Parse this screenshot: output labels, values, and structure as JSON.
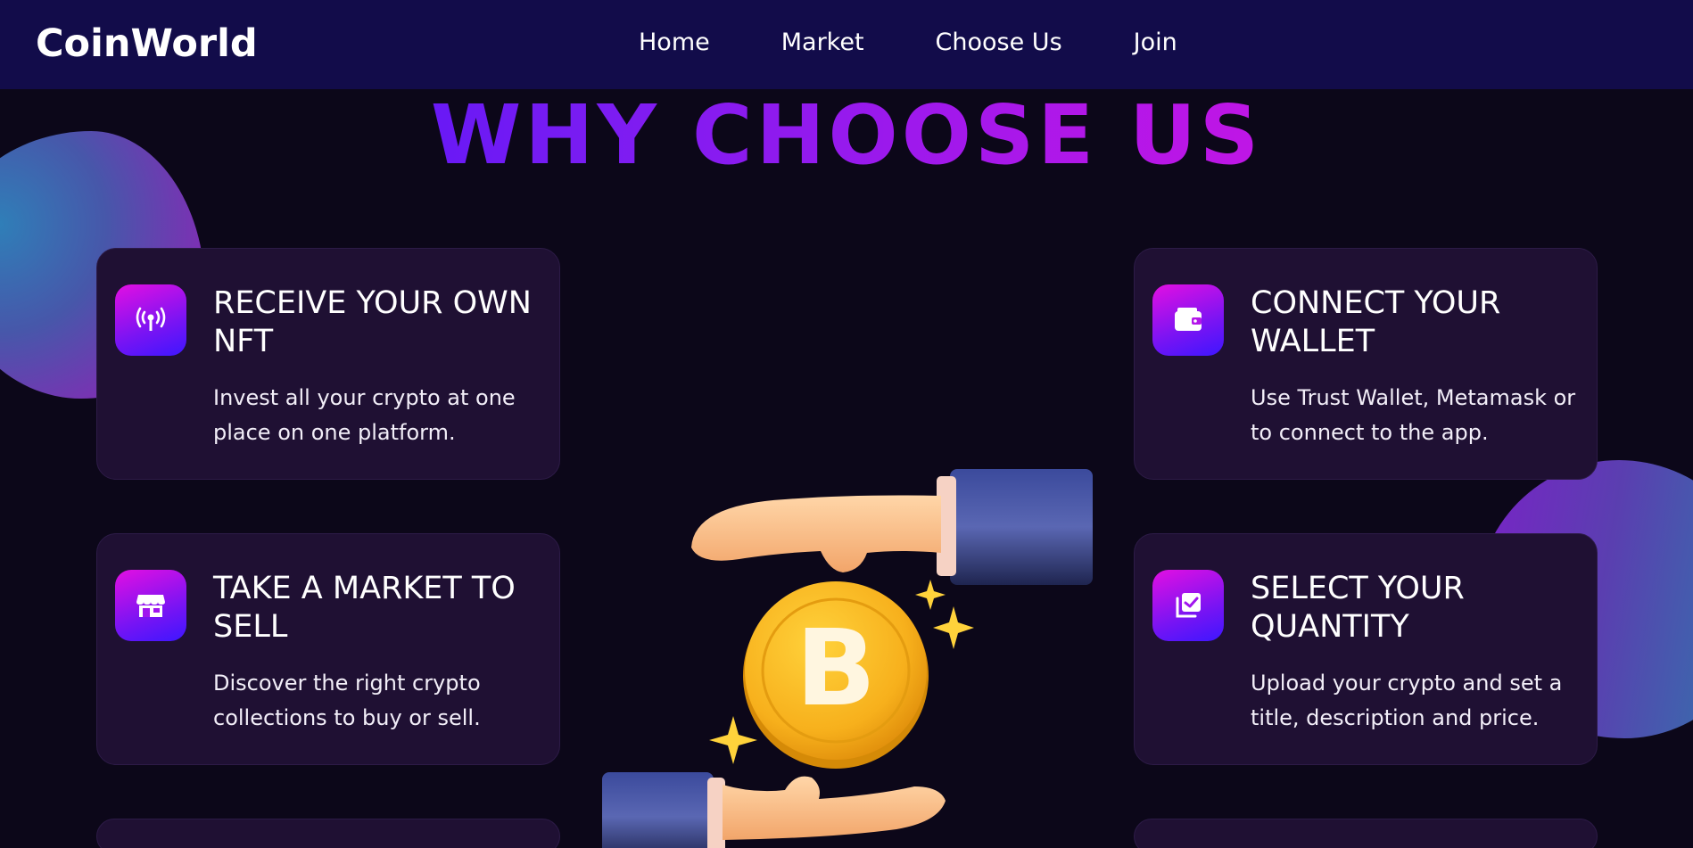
{
  "nav": {
    "logo": "CoinWorld",
    "links": [
      "Home",
      "Market",
      "Choose Us",
      "Join"
    ]
  },
  "section": {
    "title": "WHY CHOOSE US"
  },
  "cards": [
    {
      "title": "RECEIVE YOUR OWN NFT",
      "description": "Invest all your crypto at one place on one platform.",
      "icon": "broadcast-antenna-icon"
    },
    {
      "title": "CONNECT YOUR WALLET",
      "description": "Use Trust Wallet, Metamask or to connect to the app.",
      "icon": "wallet-icon"
    },
    {
      "title": "TAKE A MARKET TO SELL",
      "description": "Discover the right crypto collections to buy or sell.",
      "icon": "storefront-icon"
    },
    {
      "title": "SELECT YOUR QUANTITY",
      "description": "Upload your crypto and set a title, description and price.",
      "icon": "checklist-icon"
    }
  ],
  "illustration": {
    "icon": "bitcoin-coin-hands-icon",
    "coin_symbol": "B"
  },
  "colors": {
    "navbar_bg": "#120c4a",
    "page_bg": "#0c0719",
    "card_bg": "#1f1033",
    "gradient_start": "#3b10ff",
    "gradient_end": "#e111e0",
    "coin": "#f5b21c"
  }
}
